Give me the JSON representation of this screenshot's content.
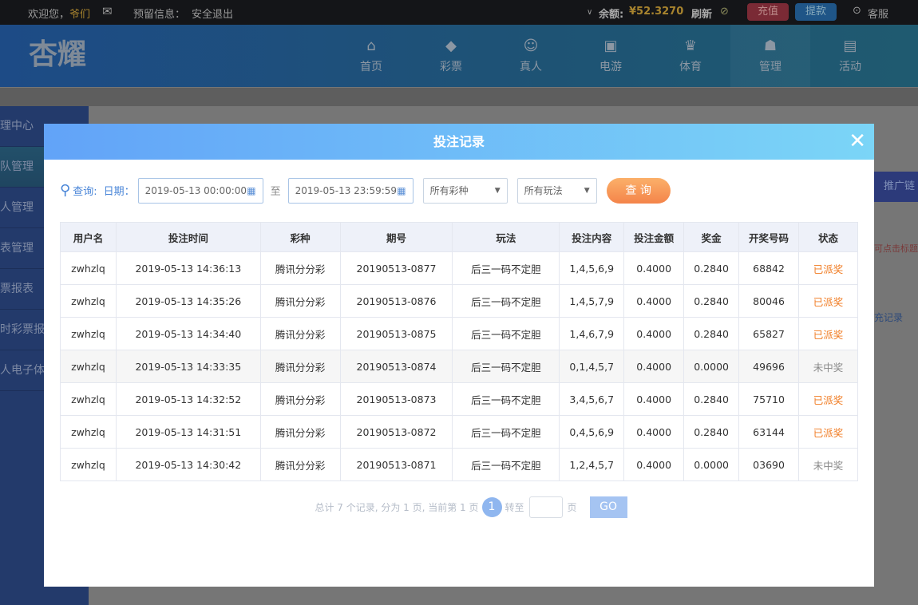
{
  "topbar": {
    "welcome": "欢迎您，",
    "username": "爷们",
    "reserved_info": "预留信息：",
    "logout": "安全退出",
    "balance_label": "余额:",
    "balance": "¥52.3270",
    "refresh": "刷新",
    "deposit": "充值",
    "withdraw": "提款",
    "service": "客服"
  },
  "header": {
    "logo": "杏耀",
    "nav": [
      {
        "label": "首页",
        "icon": "home-icon",
        "glyph": "⌂"
      },
      {
        "label": "彩票",
        "icon": "lottery-icon",
        "glyph": "◆"
      },
      {
        "label": "真人",
        "icon": "live-icon",
        "glyph": "☺"
      },
      {
        "label": "电游",
        "icon": "slot-icon",
        "glyph": "▣"
      },
      {
        "label": "体育",
        "icon": "trophy-icon",
        "glyph": "♛"
      },
      {
        "label": "管理",
        "icon": "users-icon",
        "glyph": "☗"
      },
      {
        "label": "活动",
        "icon": "gift-icon",
        "glyph": "▤"
      }
    ]
  },
  "sidebar": {
    "items": [
      "理中心",
      "队管理",
      "人管理",
      "表管理",
      "票报表",
      "时彩票报",
      "人电子体"
    ]
  },
  "background": {
    "promo": "推广链",
    "hint": "可点击标题",
    "record": "充记录"
  },
  "modal": {
    "title": "投注记录",
    "filters": {
      "query_label": "查询:",
      "date_label": "日期：",
      "start": "2019-05-13 00:00:00",
      "to": "至",
      "end": "2019-05-13 23:59:59",
      "lottery": "所有彩种",
      "play": "所有玩法",
      "search_button": "查 询"
    },
    "columns": [
      "用户名",
      "投注时间",
      "彩种",
      "期号",
      "玩法",
      "投注内容",
      "投注金额",
      "奖金",
      "开奖号码",
      "状态"
    ],
    "rows": [
      [
        "zwhzlq",
        "2019-05-13 14:36:13",
        "腾讯分分彩",
        "20190513-0877",
        "后三一码不定胆",
        "1,4,5,6,9",
        "0.4000",
        "0.2840",
        "68842",
        "已派奖"
      ],
      [
        "zwhzlq",
        "2019-05-13 14:35:26",
        "腾讯分分彩",
        "20190513-0876",
        "后三一码不定胆",
        "1,4,5,7,9",
        "0.4000",
        "0.2840",
        "80046",
        "已派奖"
      ],
      [
        "zwhzlq",
        "2019-05-13 14:34:40",
        "腾讯分分彩",
        "20190513-0875",
        "后三一码不定胆",
        "1,4,6,7,9",
        "0.4000",
        "0.2840",
        "65827",
        "已派奖"
      ],
      [
        "zwhzlq",
        "2019-05-13 14:33:35",
        "腾讯分分彩",
        "20190513-0874",
        "后三一码不定胆",
        "0,1,4,5,7",
        "0.4000",
        "0.0000",
        "49696",
        "未中奖"
      ],
      [
        "zwhzlq",
        "2019-05-13 14:32:52",
        "腾讯分分彩",
        "20190513-0873",
        "后三一码不定胆",
        "3,4,5,6,7",
        "0.4000",
        "0.2840",
        "75710",
        "已派奖"
      ],
      [
        "zwhzlq",
        "2019-05-13 14:31:51",
        "腾讯分分彩",
        "20190513-0872",
        "后三一码不定胆",
        "0,4,5,6,9",
        "0.4000",
        "0.2840",
        "63144",
        "已派奖"
      ],
      [
        "zwhzlq",
        "2019-05-13 14:30:42",
        "腾讯分分彩",
        "20190513-0871",
        "后三一码不定胆",
        "1,2,4,5,7",
        "0.4000",
        "0.0000",
        "03690",
        "未中奖"
      ]
    ],
    "pager": {
      "summary": "总计 7 个记录, 分为 1 页, 当前第 1 页",
      "page": "1",
      "goto": "转至",
      "page_unit": "页",
      "go": "GO"
    }
  }
}
